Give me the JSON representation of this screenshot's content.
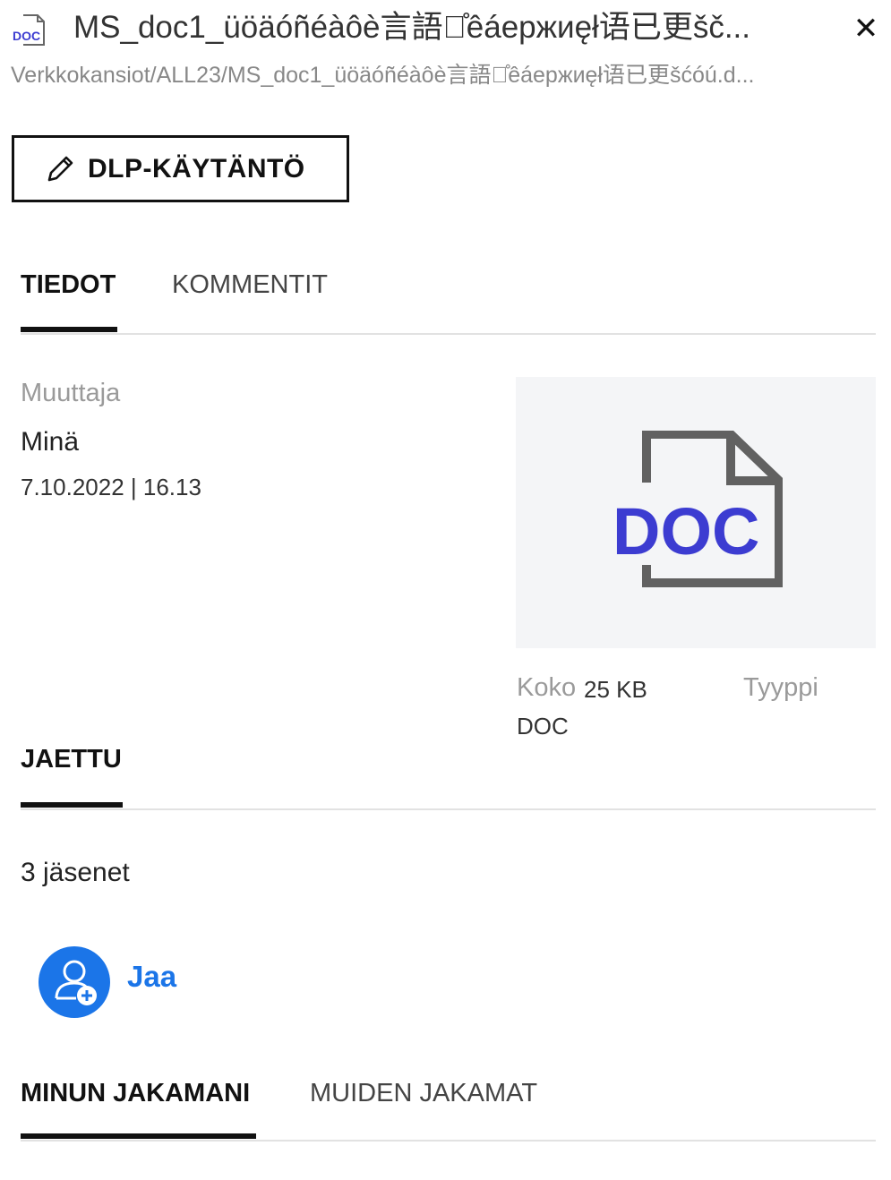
{
  "header": {
    "file_icon_label": "DOC",
    "title": "MS_doc1_üöäóñéàôè言語が̊êáержиęł语已更šč...",
    "path": "Verkkokansiot/ALL23/MS_doc1_üöäóñéàôè言語が̊êáержиęł语已更šćóú.d...",
    "close_glyph": "✕"
  },
  "actions": {
    "dlp_label": "DLP-KÄYTÄNTÖ"
  },
  "tabs": [
    {
      "label": "TIEDOT",
      "active": true
    },
    {
      "label": "KOMMENTIT",
      "active": false
    }
  ],
  "details": {
    "modified_by_label": "Muuttaja",
    "modified_by": "Minä",
    "modified_at": "7.10.2022 | 16.13",
    "preview_label": "DOC",
    "size_label": "Koko",
    "size_value": "25 KB",
    "type_label": "Tyyppi",
    "type_value": "DOC"
  },
  "shared": {
    "title": "JAETTU",
    "members": "3 jäsenet",
    "share_label": "Jaa"
  },
  "share_tabs": [
    {
      "label": "MINUN JAKAMANI",
      "active": true
    },
    {
      "label": "MUIDEN JAKAMAT",
      "active": false
    }
  ],
  "colors": {
    "accent": "#1b75e8",
    "doc_text": "#3c3cd1",
    "doc_icon_stroke": "#616161",
    "preview_bg": "#f4f5f7"
  }
}
